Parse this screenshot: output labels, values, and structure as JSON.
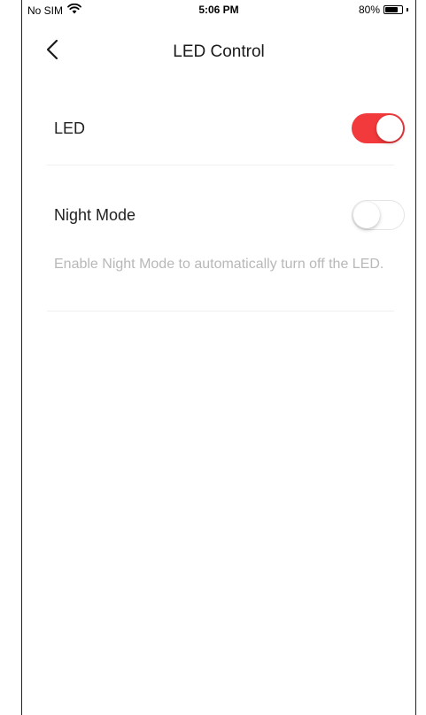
{
  "status_bar": {
    "carrier": "No SIM",
    "time": "5:06 PM",
    "battery_percent": "80%",
    "battery_level": 0.8
  },
  "nav": {
    "back_icon": "chevron-left-icon",
    "title": "LED Control"
  },
  "settings": {
    "led": {
      "label": "LED",
      "enabled": true
    },
    "night_mode": {
      "label": "Night Mode",
      "enabled": false,
      "description": "Enable Night Mode to automatically turn off the LED."
    }
  },
  "colors": {
    "accent": "#f23a3c",
    "hint_text": "#b8b8b8",
    "divider": "#efefef"
  }
}
